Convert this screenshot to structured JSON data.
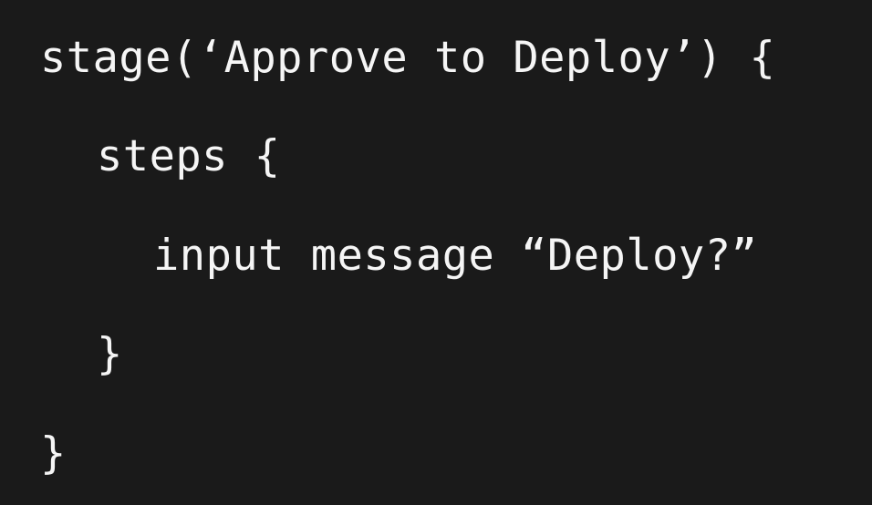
{
  "code": {
    "lines": [
      "stage(‘Approve to Deploy’) {",
      "steps {",
      "input message “Deploy?”",
      "}",
      "}"
    ]
  },
  "colors": {
    "background": "#1a1a1a",
    "text": "#f5f5f5"
  }
}
